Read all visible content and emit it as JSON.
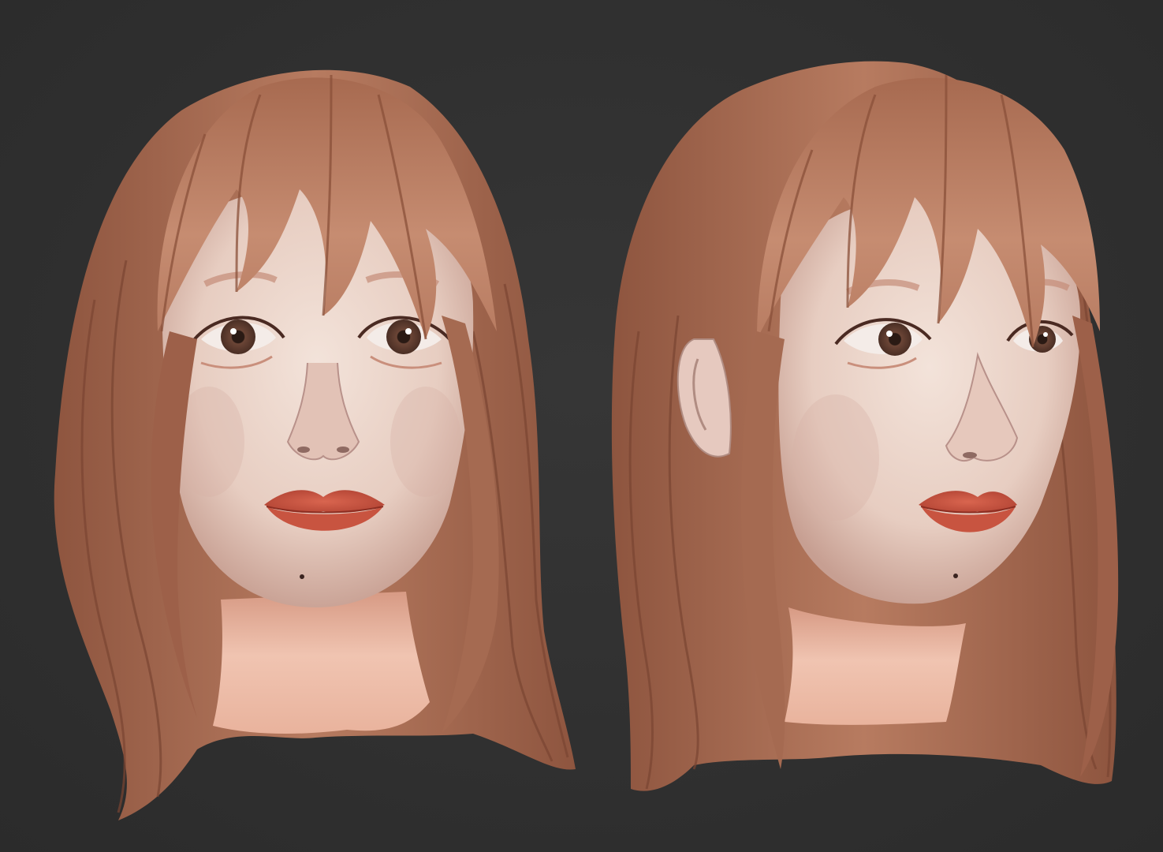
{
  "scene": {
    "background_color": "#303030",
    "hair_color": "#b0735a",
    "hair_shadow_color": "#7c4a36",
    "hair_highlight_color": "#d09a80",
    "skin_color": "#ecd6cc",
    "skin_shadow_color": "#c9a598",
    "neck_color": "#e8b6a0",
    "lip_color": "#c8503c",
    "iris_color": "#5a3a2e",
    "views": [
      {
        "name": "front-view",
        "pose": "frontal"
      },
      {
        "name": "three-quarter-view",
        "pose": "three-quarter"
      }
    ]
  }
}
